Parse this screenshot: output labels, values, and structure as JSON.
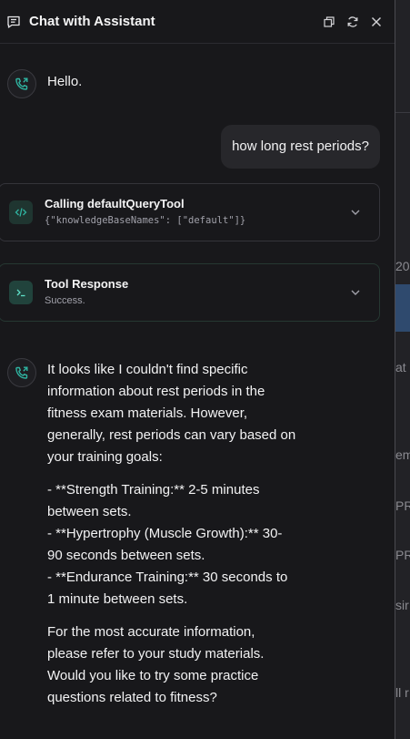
{
  "header": {
    "title": "Chat with Assistant"
  },
  "messages": {
    "greeting": "Hello.",
    "user_question": "how long rest periods?",
    "tool_call": {
      "title": "Calling defaultQueryTool",
      "args": "{\"knowledgeBaseNames\": [\"default\"]}"
    },
    "tool_response": {
      "title": "Tool Response",
      "status": "Success."
    },
    "answer": {
      "intro": "It looks like I couldn't find specific information about rest periods in the fitness exam materials. However, generally, rest periods can vary based on your training goals:",
      "items": [
        "- **Strength Training:** 2-5 minutes between sets.",
        "- **Hypertrophy (Muscle Growth):** 30-90 seconds between sets.",
        "- **Endurance Training:** 30 seconds to 1 minute between sets."
      ],
      "closing": "For the most accurate information, please refer to your study materials. Would you like to try some practice questions related to fitness?"
    }
  },
  "background": {
    "fragments": [
      "20",
      "at c",
      "em",
      "PR",
      "PR",
      "sir",
      "ll r"
    ]
  },
  "colors": {
    "panel_bg": "#18181b",
    "bubble_bg": "#27272b",
    "accent_teal": "#2fb3a0",
    "background_blue": "#2f4a6e"
  },
  "icons": {
    "header": [
      "chat-icon",
      "popout-icon",
      "refresh-icon",
      "close-icon"
    ],
    "avatar": "phone-forward-icon",
    "tool_call": "code-icon",
    "tool_response": "terminal-icon",
    "expand": "chevron-down-icon"
  }
}
